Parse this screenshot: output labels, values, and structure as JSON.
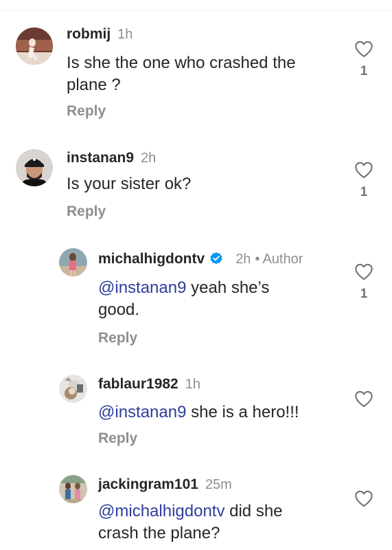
{
  "comments": [
    {
      "username": "robmij",
      "time": "1h",
      "text": "Is she the one who crashed the plane ?",
      "reply_label": "Reply",
      "likes": "1",
      "icons": {
        "avatar": "user-avatar",
        "like": "heart-outline-icon"
      }
    },
    {
      "username": "instanan9",
      "time": "2h",
      "text": "Is your sister ok?",
      "reply_label": "Reply",
      "likes": "1",
      "icons": {
        "avatar": "user-avatar",
        "like": "heart-outline-icon"
      }
    }
  ],
  "replies": [
    {
      "username": "michalhigdontv",
      "verified": true,
      "time": "2h",
      "separator": "•",
      "author_label": "Author",
      "mention": "@instanan9",
      "text": " yeah she’s good.",
      "reply_label": "Reply",
      "likes": "1",
      "icons": {
        "avatar": "user-avatar",
        "verified": "verified-badge-icon",
        "like": "heart-outline-icon"
      }
    },
    {
      "username": "fablaur1982",
      "time": "1h",
      "mention": "@instanan9",
      "text": " she is a hero!!!",
      "reply_label": "Reply",
      "icons": {
        "avatar": "user-avatar",
        "like": "heart-outline-icon"
      }
    },
    {
      "username": "jackingram101",
      "time": "25m",
      "mention": "@michalhigdontv",
      "text": " did she crash the plane?",
      "icons": {
        "avatar": "user-avatar",
        "like": "heart-outline-icon"
      }
    }
  ],
  "colors": {
    "text": "#262626",
    "muted": "#8e8e8e",
    "mention": "#2f3d9d",
    "verified": "#0095f6"
  }
}
